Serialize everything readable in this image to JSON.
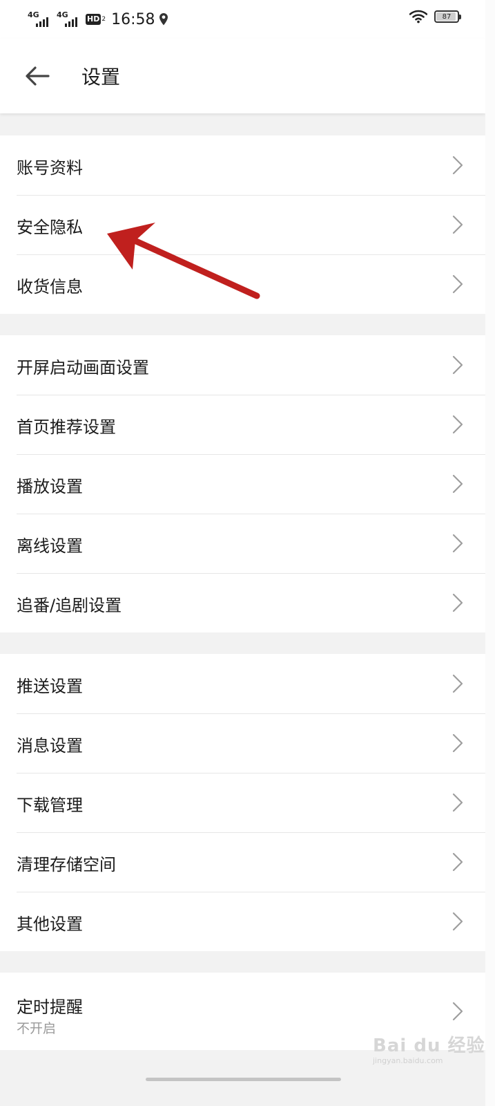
{
  "status_bar": {
    "network_1": "4G",
    "network_2": "4G",
    "hd_label": "HD",
    "hd_sub": "2",
    "time": "16:58",
    "battery": "87"
  },
  "header": {
    "title": "设置"
  },
  "groups": [
    {
      "items": [
        {
          "label": "账号资料"
        },
        {
          "label": "安全隐私"
        },
        {
          "label": "收货信息"
        }
      ]
    },
    {
      "items": [
        {
          "label": "开屏启动画面设置"
        },
        {
          "label": "首页推荐设置"
        },
        {
          "label": "播放设置"
        },
        {
          "label": "离线设置"
        },
        {
          "label": "追番/追剧设置"
        }
      ]
    },
    {
      "items": [
        {
          "label": "推送设置"
        },
        {
          "label": "消息设置"
        },
        {
          "label": "下载管理"
        },
        {
          "label": "清理存储空间"
        },
        {
          "label": "其他设置"
        }
      ]
    },
    {
      "items": [
        {
          "label": "定时提醒",
          "value": "不开启"
        }
      ]
    }
  ],
  "annotation": {
    "color": "#c0201e",
    "target": "安全隐私"
  },
  "watermark": {
    "text": "Bai du 经验",
    "sub": "jingyan.baidu.com"
  },
  "colors": {
    "page_bg": "#f2f2f2",
    "card_bg": "#ffffff",
    "divider": "#e6e6e6",
    "chevron": "#9e9e9e"
  }
}
